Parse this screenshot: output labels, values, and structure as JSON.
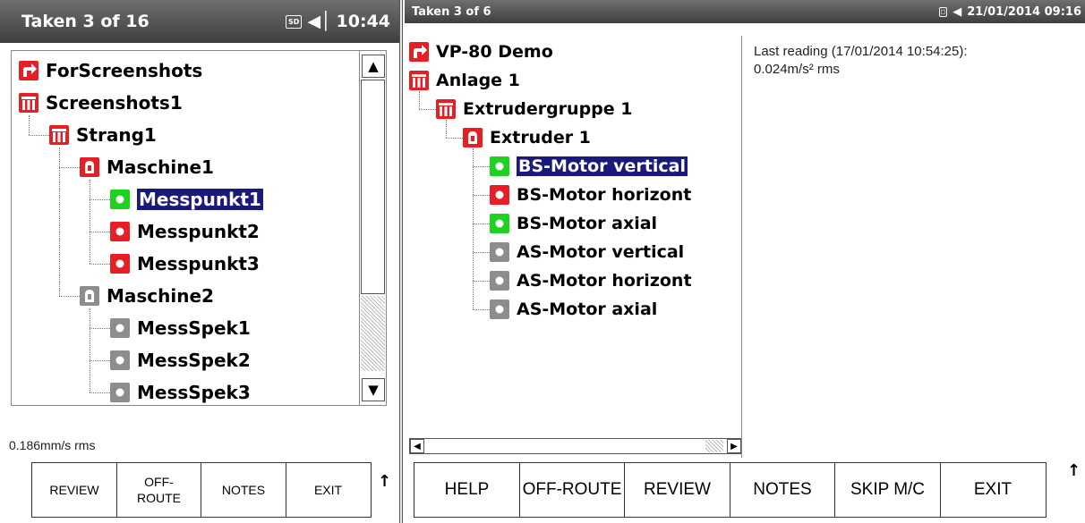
{
  "left": {
    "title": "Taken 3 of 16",
    "sd_label": "SD",
    "time": "10:44",
    "tree": [
      {
        "label": "ForScreenshots",
        "icon": "route-icon",
        "icon_color": "#e81e25"
      },
      {
        "label": "Screenshots1",
        "icon": "site-icon",
        "icon_color": "#e81e25"
      },
      {
        "label": "Strang1",
        "icon": "site-icon",
        "icon_color": "#e81e25"
      },
      {
        "label": "Maschine1",
        "icon": "machine-icon",
        "icon_color": "#e81e25"
      },
      {
        "label": "Messpunkt1",
        "icon": "measurement-point-icon",
        "icon_color": "#1fd21f",
        "selected": true
      },
      {
        "label": "Messpunkt2",
        "icon": "measurement-point-icon",
        "icon_color": "#e81e25"
      },
      {
        "label": "Messpunkt3",
        "icon": "measurement-point-icon",
        "icon_color": "#e81e25"
      },
      {
        "label": "Maschine2",
        "icon": "machine-icon",
        "icon_color": "#8d8d8d"
      },
      {
        "label": "MessSpek1",
        "icon": "measurement-point-icon",
        "icon_color": "#8d8d8d"
      },
      {
        "label": "MessSpek2",
        "icon": "measurement-point-icon",
        "icon_color": "#8d8d8d"
      },
      {
        "label": "MessSpek3",
        "icon": "measurement-point-icon",
        "icon_color": "#8d8d8d"
      }
    ],
    "reading": "0.186mm/s rms",
    "buttons": [
      "REVIEW",
      "OFF-\nROUTE",
      "NOTES",
      "EXIT"
    ]
  },
  "right": {
    "title": "Taken 3 of 6",
    "datetime": "21/01/2014 09:16",
    "tree": [
      {
        "label": "VP-80 Demo",
        "icon": "route-icon",
        "icon_color": "#e81e25"
      },
      {
        "label": "Anlage 1",
        "icon": "site-icon",
        "icon_color": "#e81e25"
      },
      {
        "label": "Extrudergruppe 1",
        "icon": "site-icon",
        "icon_color": "#e81e25"
      },
      {
        "label": "Extruder 1",
        "icon": "machine-icon",
        "icon_color": "#e81e25"
      },
      {
        "label": "BS-Motor vertical",
        "icon": "measurement-point-icon",
        "icon_color": "#1fd21f",
        "selected": true
      },
      {
        "label": "BS-Motor horizont",
        "icon": "measurement-point-icon",
        "icon_color": "#e81e25"
      },
      {
        "label": "BS-Motor axial",
        "icon": "measurement-point-icon",
        "icon_color": "#1fd21f"
      },
      {
        "label": "AS-Motor vertical",
        "icon": "measurement-point-icon",
        "icon_color": "#8d8d8d"
      },
      {
        "label": "AS-Motor horizont",
        "icon": "measurement-point-icon",
        "icon_color": "#8d8d8d"
      },
      {
        "label": "AS-Motor axial",
        "icon": "measurement-point-icon",
        "icon_color": "#8d8d8d"
      }
    ],
    "reading_line1": "Last reading (17/01/2014 10:54:25):",
    "reading_line2": "0.024m/s² rms",
    "buttons": [
      "HELP",
      "OFF-ROUTE",
      "REVIEW",
      "NOTES",
      "SKIP M/C",
      "EXIT"
    ]
  }
}
